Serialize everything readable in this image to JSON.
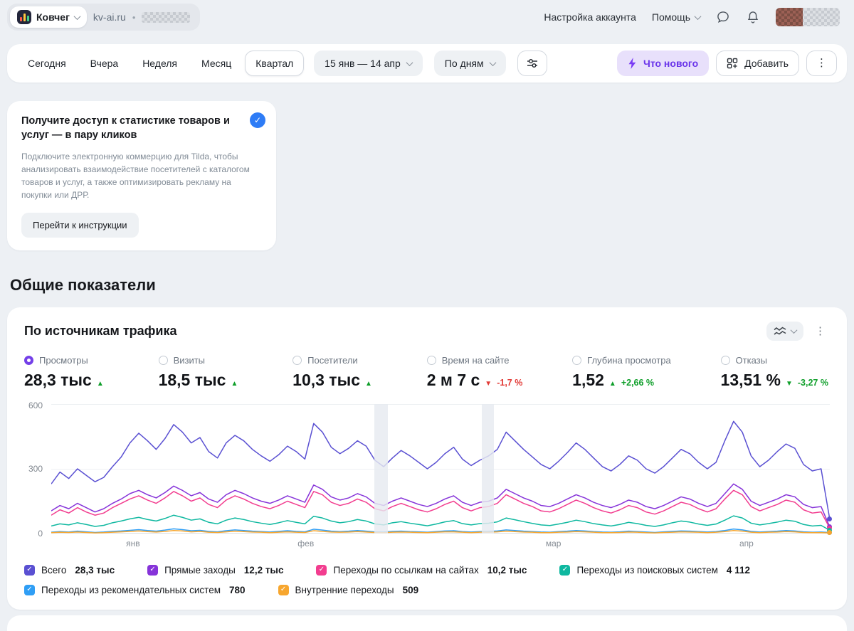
{
  "header": {
    "counter_name": "Ковчег",
    "site": "kv-ai.ru",
    "dot": "•",
    "account_settings": "Настройка аккаунта",
    "help": "Помощь"
  },
  "toolbar": {
    "periods": [
      "Сегодня",
      "Вчера",
      "Неделя",
      "Месяц",
      "Квартал"
    ],
    "active_period": "Квартал",
    "date_range": "15 янв — 14 апр",
    "grouping": "По дням",
    "whats_new": "Что нового",
    "add": "Добавить"
  },
  "promo": {
    "title": "Получите доступ к статистике товаров и услуг — в пару кликов",
    "body": "Подключите электронную коммерцию для Tilda, чтобы анализировать взаимодействие посетителей с каталогом товаров и услуг, а также оптимизировать рекламу на покупки или ДРР.",
    "button": "Перейти к инструкции"
  },
  "section_title": "Общие показатели",
  "card": {
    "title": "По источникам трафика",
    "metrics": [
      {
        "label": "Просмотры",
        "value": "28,3 тыс",
        "arrow": "▲",
        "delta": "",
        "selected": true
      },
      {
        "label": "Визиты",
        "value": "18,5 тыс",
        "arrow": "▲",
        "delta": ""
      },
      {
        "label": "Посетители",
        "value": "10,3 тыс",
        "arrow": "▲",
        "delta": ""
      },
      {
        "label": "Время на сайте",
        "value": "2 м 7 с",
        "arrow": "▼",
        "delta": "-1,7 %"
      },
      {
        "label": "Глубина просмотра",
        "value": "1,52",
        "arrow": "▲",
        "delta": "+2,66 %"
      },
      {
        "label": "Отказы",
        "value": "13,51 %",
        "arrow": "▼",
        "delta": "-3,27 %"
      }
    ],
    "legend": [
      {
        "label": "Всего",
        "value": "28,3 тыс"
      },
      {
        "label": "Прямые заходы",
        "value": "12,2 тыс"
      },
      {
        "label": "Переходы по ссылкам на сайтах",
        "value": "10,2 тыс"
      },
      {
        "label": "Переходы из поисковых систем",
        "value": "4 112"
      },
      {
        "label": "Переходы из рекомендательных систем",
        "value": "780"
      },
      {
        "label": "Внутренние переходы",
        "value": "509"
      }
    ]
  },
  "chart_data": {
    "type": "line",
    "title": "По источникам трафика",
    "x_range": "15 янв — 14 апр, по дням",
    "ylim": [
      0,
      600
    ],
    "y_ticks": [
      600,
      300,
      0
    ],
    "x_labels": [
      {
        "text": "янв",
        "pos": 0.105
      },
      {
        "text": "фев",
        "pos": 0.327
      },
      {
        "text": "мар",
        "pos": 0.645
      },
      {
        "text": "апр",
        "pos": 0.893
      }
    ],
    "highlight_bands": [
      {
        "start": 0.415,
        "end": 0.432
      },
      {
        "start": 0.553,
        "end": 0.569
      }
    ],
    "series": [
      {
        "name": "Всего",
        "total": "28,3 тыс",
        "color": "#5a50d2",
        "values": [
          230,
          285,
          255,
          300,
          270,
          240,
          260,
          310,
          355,
          420,
          465,
          430,
          390,
          440,
          505,
          470,
          420,
          445,
          380,
          350,
          420,
          455,
          430,
          390,
          360,
          335,
          365,
          405,
          380,
          345,
          510,
          470,
          400,
          370,
          395,
          430,
          405,
          340,
          310,
          350,
          385,
          360,
          330,
          300,
          330,
          370,
          400,
          345,
          315,
          340,
          360,
          390,
          470,
          430,
          390,
          355,
          320,
          300,
          335,
          375,
          420,
          390,
          350,
          310,
          290,
          320,
          360,
          340,
          300,
          280,
          310,
          350,
          390,
          370,
          330,
          300,
          330,
          430,
          520,
          470,
          360,
          310,
          340,
          380,
          415,
          395,
          320,
          290,
          300,
          65
        ]
      },
      {
        "name": "Прямые заходы",
        "total": "12,2 тыс",
        "color": "#8633d9",
        "values": [
          105,
          130,
          115,
          140,
          120,
          100,
          115,
          140,
          160,
          185,
          200,
          180,
          165,
          190,
          220,
          200,
          175,
          190,
          160,
          145,
          180,
          200,
          185,
          165,
          150,
          140,
          155,
          175,
          160,
          145,
          225,
          205,
          170,
          155,
          165,
          185,
          170,
          140,
          130,
          150,
          165,
          150,
          135,
          125,
          140,
          160,
          175,
          145,
          130,
          145,
          150,
          165,
          205,
          185,
          165,
          150,
          130,
          125,
          140,
          160,
          180,
          165,
          145,
          130,
          120,
          135,
          155,
          145,
          125,
          115,
          130,
          150,
          170,
          160,
          140,
          125,
          140,
          185,
          230,
          205,
          150,
          130,
          145,
          160,
          180,
          170,
          135,
          120,
          125,
          30
        ]
      },
      {
        "name": "Переходы по ссылкам на сайтах",
        "total": "10,2 тыс",
        "color": "#f23d8f",
        "values": [
          85,
          110,
          95,
          120,
          100,
          85,
          95,
          120,
          140,
          160,
          175,
          155,
          140,
          165,
          195,
          175,
          150,
          165,
          135,
          120,
          155,
          175,
          160,
          140,
          125,
          115,
          130,
          150,
          135,
          120,
          195,
          180,
          145,
          130,
          140,
          160,
          145,
          115,
          105,
          125,
          140,
          125,
          110,
          100,
          115,
          135,
          150,
          120,
          105,
          120,
          125,
          140,
          180,
          160,
          140,
          125,
          105,
          100,
          115,
          135,
          155,
          140,
          120,
          105,
          95,
          110,
          130,
          120,
          100,
          90,
          105,
          125,
          145,
          135,
          115,
          100,
          115,
          160,
          200,
          180,
          125,
          105,
          120,
          135,
          155,
          145,
          110,
          95,
          100,
          25
        ]
      },
      {
        "name": "Переходы из поисковых систем",
        "total": "4 112",
        "color": "#0fb8a0",
        "values": [
          35,
          45,
          40,
          50,
          42,
          33,
          38,
          50,
          58,
          68,
          75,
          65,
          58,
          70,
          85,
          75,
          62,
          68,
          52,
          45,
          62,
          72,
          65,
          55,
          48,
          42,
          50,
          60,
          52,
          45,
          80,
          72,
          58,
          50,
          55,
          65,
          58,
          45,
          40,
          50,
          55,
          48,
          42,
          36,
          44,
          54,
          60,
          46,
          40,
          46,
          48,
          54,
          72,
          64,
          55,
          47,
          40,
          37,
          44,
          52,
          62,
          55,
          46,
          40,
          35,
          42,
          52,
          46,
          38,
          33,
          40,
          50,
          58,
          53,
          44,
          38,
          44,
          62,
          82,
          72,
          48,
          40,
          46,
          53,
          62,
          57,
          42,
          35,
          38,
          15
        ]
      },
      {
        "name": "Переходы из рекомендательных систем",
        "total": "780",
        "color": "#2f9ef5",
        "values": [
          6,
          9,
          7,
          11,
          8,
          5,
          7,
          10,
          12,
          15,
          18,
          14,
          11,
          16,
          22,
          18,
          13,
          15,
          10,
          8,
          13,
          17,
          14,
          11,
          9,
          7,
          10,
          13,
          10,
          8,
          20,
          16,
          11,
          9,
          11,
          14,
          11,
          8,
          7,
          10,
          11,
          9,
          8,
          6,
          9,
          12,
          13,
          9,
          7,
          9,
          10,
          12,
          17,
          14,
          11,
          9,
          7,
          6,
          9,
          11,
          14,
          12,
          9,
          7,
          6,
          8,
          11,
          9,
          7,
          5,
          8,
          10,
          12,
          11,
          9,
          7,
          9,
          14,
          21,
          17,
          10,
          7,
          9,
          11,
          14,
          12,
          8,
          6,
          7,
          5
        ]
      },
      {
        "name": "Внутренние переходы",
        "total": "509",
        "color": "#f7a62e",
        "values": [
          4,
          6,
          5,
          7,
          5,
          3,
          4,
          6,
          8,
          10,
          12,
          9,
          7,
          10,
          14,
          12,
          8,
          10,
          6,
          5,
          8,
          11,
          9,
          7,
          6,
          4,
          6,
          8,
          6,
          5,
          13,
          10,
          7,
          6,
          7,
          9,
          7,
          5,
          4,
          6,
          7,
          6,
          5,
          4,
          6,
          8,
          8,
          6,
          4,
          6,
          6,
          8,
          11,
          9,
          7,
          6,
          4,
          4,
          6,
          7,
          9,
          8,
          6,
          4,
          4,
          5,
          7,
          6,
          4,
          3,
          5,
          6,
          8,
          7,
          6,
          4,
          6,
          9,
          14,
          11,
          6,
          4,
          6,
          7,
          9,
          8,
          5,
          4,
          4,
          3
        ]
      }
    ]
  }
}
